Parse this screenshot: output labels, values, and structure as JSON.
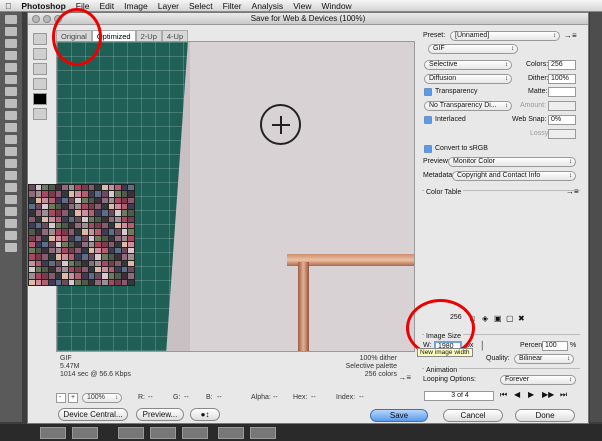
{
  "menubar": {
    "apple": "",
    "app": "Photoshop",
    "items": [
      "File",
      "Edit",
      "Image",
      "Layer",
      "Select",
      "Filter",
      "Analysis",
      "View",
      "Window"
    ]
  },
  "dialog": {
    "title": "Save for Web & Devices (100%)"
  },
  "tabs": [
    "Original",
    "Optimized",
    "2-Up",
    "4-Up"
  ],
  "active_tab": "Optimized",
  "info": {
    "left": [
      "GIF",
      "5.47M",
      "1014 sec @ 56.6 Kbps"
    ],
    "right": [
      "100% dither",
      "Selective palette",
      "256 colors"
    ]
  },
  "statusbar": {
    "zoom": "100%",
    "r": "R:",
    "r_val": "--",
    "g": "G:",
    "g_val": "--",
    "b": "B:",
    "b_val": "--",
    "alpha": "Alpha:",
    "alpha_val": "--",
    "hex": "Hex:",
    "hex_val": "--",
    "index": "Index:",
    "index_val": "--"
  },
  "buttons": {
    "device_central": "Device Central...",
    "preview": "Preview...",
    "save": "Save",
    "cancel": "Cancel",
    "done": "Done"
  },
  "settings": {
    "preset_label": "Preset:",
    "preset": "[Unnamed]",
    "format": "GIF",
    "reduction": "Selective",
    "colors_label": "Colors:",
    "colors": "256",
    "dither_algo": "Diffusion",
    "dither_label": "Dither:",
    "dither": "100%",
    "transparency_label": "Transparency",
    "matte_label": "Matte:",
    "trans_dither": "No Transparency Di...",
    "amount_label": "Amount:",
    "interlaced_label": "Interlaced",
    "websnap_label": "Web Snap:",
    "websnap": "0%",
    "lossy_label": "Lossy:",
    "srgb_label": "Convert to sRGB",
    "preview_label": "Preview:",
    "preview_val": "Monitor Color",
    "metadata_label": "Metadata:",
    "metadata_val": "Copyright and Contact Info"
  },
  "color_table": {
    "title": "Color Table",
    "count": "256",
    "colors": [
      "#6b4a5e",
      "#a9475f",
      "#3f3b57",
      "#8f6c7b",
      "#c98fa0",
      "#4e5a4a",
      "#2f3a3f",
      "#d8c9cf",
      "#7a3b4f",
      "#5e6e86",
      "#9c8f94",
      "#b45f6e",
      "#3b2f3a",
      "#e0b9a6",
      "#6e7a5e",
      "#8a5a6e"
    ]
  },
  "image_size": {
    "title": "Image Size",
    "w_label": "W:",
    "w": "1980",
    "unit": "px",
    "percent_label": "Percent:",
    "percent": "100",
    "pct": "%",
    "quality_label": "Quality:",
    "quality": "Bilinear",
    "tooltip": "New image width"
  },
  "animation": {
    "title": "Animation",
    "looping_label": "Looping Options:",
    "looping": "Forever",
    "frame": "3 of 4"
  }
}
